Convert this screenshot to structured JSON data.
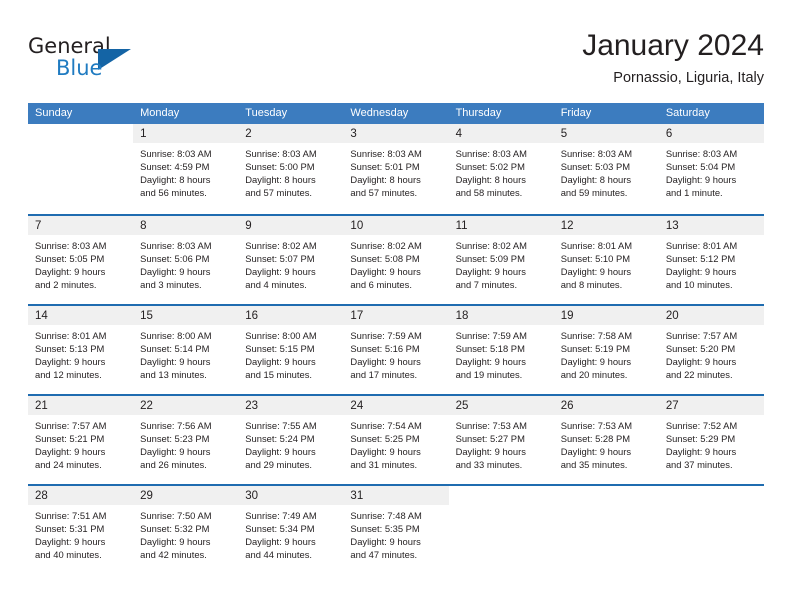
{
  "brand": {
    "name_part1": "General",
    "name_part2": "Blue",
    "accent_color": "#1464a5"
  },
  "header": {
    "title": "January 2024",
    "subtitle": "Pornassio, Liguria, Italy"
  },
  "colors": {
    "header_blue": "#3c7cbf",
    "row_divider_blue": "#1f6cb0",
    "daynum_bg": "#f0f0f0",
    "text": "#231f20"
  },
  "weekday_headers": [
    "Sunday",
    "Monday",
    "Tuesday",
    "Wednesday",
    "Thursday",
    "Friday",
    "Saturday"
  ],
  "weeks": [
    [
      {
        "day": "",
        "lines": [
          "",
          "",
          "",
          ""
        ],
        "empty": true
      },
      {
        "day": "1",
        "lines": [
          "Sunrise: 8:03 AM",
          "Sunset: 4:59 PM",
          "Daylight: 8 hours",
          "and 56 minutes."
        ]
      },
      {
        "day": "2",
        "lines": [
          "Sunrise: 8:03 AM",
          "Sunset: 5:00 PM",
          "Daylight: 8 hours",
          "and 57 minutes."
        ]
      },
      {
        "day": "3",
        "lines": [
          "Sunrise: 8:03 AM",
          "Sunset: 5:01 PM",
          "Daylight: 8 hours",
          "and 57 minutes."
        ]
      },
      {
        "day": "4",
        "lines": [
          "Sunrise: 8:03 AM",
          "Sunset: 5:02 PM",
          "Daylight: 8 hours",
          "and 58 minutes."
        ]
      },
      {
        "day": "5",
        "lines": [
          "Sunrise: 8:03 AM",
          "Sunset: 5:03 PM",
          "Daylight: 8 hours",
          "and 59 minutes."
        ]
      },
      {
        "day": "6",
        "lines": [
          "Sunrise: 8:03 AM",
          "Sunset: 5:04 PM",
          "Daylight: 9 hours",
          "and 1 minute."
        ]
      }
    ],
    [
      {
        "day": "7",
        "lines": [
          "Sunrise: 8:03 AM",
          "Sunset: 5:05 PM",
          "Daylight: 9 hours",
          "and 2 minutes."
        ]
      },
      {
        "day": "8",
        "lines": [
          "Sunrise: 8:03 AM",
          "Sunset: 5:06 PM",
          "Daylight: 9 hours",
          "and 3 minutes."
        ]
      },
      {
        "day": "9",
        "lines": [
          "Sunrise: 8:02 AM",
          "Sunset: 5:07 PM",
          "Daylight: 9 hours",
          "and 4 minutes."
        ]
      },
      {
        "day": "10",
        "lines": [
          "Sunrise: 8:02 AM",
          "Sunset: 5:08 PM",
          "Daylight: 9 hours",
          "and 6 minutes."
        ]
      },
      {
        "day": "11",
        "lines": [
          "Sunrise: 8:02 AM",
          "Sunset: 5:09 PM",
          "Daylight: 9 hours",
          "and 7 minutes."
        ]
      },
      {
        "day": "12",
        "lines": [
          "Sunrise: 8:01 AM",
          "Sunset: 5:10 PM",
          "Daylight: 9 hours",
          "and 8 minutes."
        ]
      },
      {
        "day": "13",
        "lines": [
          "Sunrise: 8:01 AM",
          "Sunset: 5:12 PM",
          "Daylight: 9 hours",
          "and 10 minutes."
        ]
      }
    ],
    [
      {
        "day": "14",
        "lines": [
          "Sunrise: 8:01 AM",
          "Sunset: 5:13 PM",
          "Daylight: 9 hours",
          "and 12 minutes."
        ]
      },
      {
        "day": "15",
        "lines": [
          "Sunrise: 8:00 AM",
          "Sunset: 5:14 PM",
          "Daylight: 9 hours",
          "and 13 minutes."
        ]
      },
      {
        "day": "16",
        "lines": [
          "Sunrise: 8:00 AM",
          "Sunset: 5:15 PM",
          "Daylight: 9 hours",
          "and 15 minutes."
        ]
      },
      {
        "day": "17",
        "lines": [
          "Sunrise: 7:59 AM",
          "Sunset: 5:16 PM",
          "Daylight: 9 hours",
          "and 17 minutes."
        ]
      },
      {
        "day": "18",
        "lines": [
          "Sunrise: 7:59 AM",
          "Sunset: 5:18 PM",
          "Daylight: 9 hours",
          "and 19 minutes."
        ]
      },
      {
        "day": "19",
        "lines": [
          "Sunrise: 7:58 AM",
          "Sunset: 5:19 PM",
          "Daylight: 9 hours",
          "and 20 minutes."
        ]
      },
      {
        "day": "20",
        "lines": [
          "Sunrise: 7:57 AM",
          "Sunset: 5:20 PM",
          "Daylight: 9 hours",
          "and 22 minutes."
        ]
      }
    ],
    [
      {
        "day": "21",
        "lines": [
          "Sunrise: 7:57 AM",
          "Sunset: 5:21 PM",
          "Daylight: 9 hours",
          "and 24 minutes."
        ]
      },
      {
        "day": "22",
        "lines": [
          "Sunrise: 7:56 AM",
          "Sunset: 5:23 PM",
          "Daylight: 9 hours",
          "and 26 minutes."
        ]
      },
      {
        "day": "23",
        "lines": [
          "Sunrise: 7:55 AM",
          "Sunset: 5:24 PM",
          "Daylight: 9 hours",
          "and 29 minutes."
        ]
      },
      {
        "day": "24",
        "lines": [
          "Sunrise: 7:54 AM",
          "Sunset: 5:25 PM",
          "Daylight: 9 hours",
          "and 31 minutes."
        ]
      },
      {
        "day": "25",
        "lines": [
          "Sunrise: 7:53 AM",
          "Sunset: 5:27 PM",
          "Daylight: 9 hours",
          "and 33 minutes."
        ]
      },
      {
        "day": "26",
        "lines": [
          "Sunrise: 7:53 AM",
          "Sunset: 5:28 PM",
          "Daylight: 9 hours",
          "and 35 minutes."
        ]
      },
      {
        "day": "27",
        "lines": [
          "Sunrise: 7:52 AM",
          "Sunset: 5:29 PM",
          "Daylight: 9 hours",
          "and 37 minutes."
        ]
      }
    ],
    [
      {
        "day": "28",
        "lines": [
          "Sunrise: 7:51 AM",
          "Sunset: 5:31 PM",
          "Daylight: 9 hours",
          "and 40 minutes."
        ]
      },
      {
        "day": "29",
        "lines": [
          "Sunrise: 7:50 AM",
          "Sunset: 5:32 PM",
          "Daylight: 9 hours",
          "and 42 minutes."
        ]
      },
      {
        "day": "30",
        "lines": [
          "Sunrise: 7:49 AM",
          "Sunset: 5:34 PM",
          "Daylight: 9 hours",
          "and 44 minutes."
        ]
      },
      {
        "day": "31",
        "lines": [
          "Sunrise: 7:48 AM",
          "Sunset: 5:35 PM",
          "Daylight: 9 hours",
          "and 47 minutes."
        ]
      },
      {
        "day": "",
        "lines": [
          "",
          "",
          "",
          ""
        ],
        "empty": true
      },
      {
        "day": "",
        "lines": [
          "",
          "",
          "",
          ""
        ],
        "empty": true
      },
      {
        "day": "",
        "lines": [
          "",
          "",
          "",
          ""
        ],
        "empty": true
      }
    ]
  ]
}
